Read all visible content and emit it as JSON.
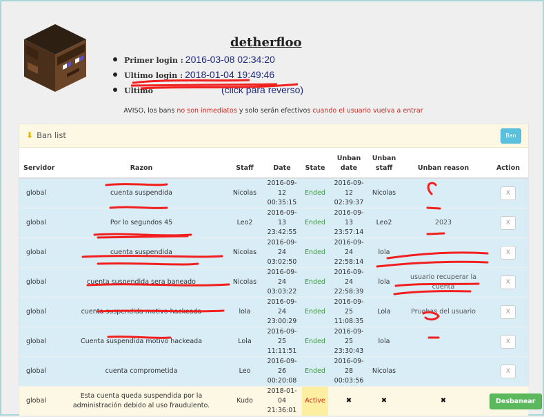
{
  "profile": {
    "username": "detherfloo",
    "first_login_label": "Primer login :",
    "first_login_value": "2016-03-08 02:34:20",
    "last_login_label": "Ultimo login :",
    "last_login_value": "2018-01-04 19:49:46",
    "last_ip_label": "Ultimo",
    "last_ip_value": "(click para reverso)"
  },
  "notice": {
    "prefix": "AVISO, los bans ",
    "highlight1": "no son inmediatos",
    "middle": " y solo serán efectivos ",
    "highlight2": "cuando el usuario vuelva a entrar"
  },
  "panel": {
    "title": "Ban list",
    "ban_button": "Ban"
  },
  "table": {
    "headers": [
      "Servidor",
      "Razon",
      "Staff",
      "Date",
      "State",
      "Unban date",
      "Unban staff",
      "Unban reason",
      "Action"
    ],
    "rows": [
      {
        "server": "global",
        "reason": "cuenta suspendida",
        "staff": "Nicolas",
        "date": "2016-09-12 00:35:15",
        "state": "Ended",
        "unban_date": "2016-09-12 02:39:37",
        "unban_staff": "Nicolas",
        "unban_reason": "",
        "action": "X"
      },
      {
        "server": "global",
        "reason": "Por lo segundos 45",
        "staff": "Leo2",
        "date": "2016-09-13 23:42:55",
        "state": "Ended",
        "unban_date": "2016-09-13 23:57:14",
        "unban_staff": "Leo2",
        "unban_reason": "2023",
        "action": "X"
      },
      {
        "server": "global",
        "reason": "cuenta suspendida",
        "staff": "Nicolas",
        "date": "2016-09-24 03:02:50",
        "state": "Ended",
        "unban_date": "2016-09-24 22:58:14",
        "unban_staff": "lola",
        "unban_reason": "",
        "action": "X"
      },
      {
        "server": "global",
        "reason": "cuenta suspendida sera baneado",
        "staff": "Nicolas",
        "date": "2016-09-24 03:03:22",
        "state": "Ended",
        "unban_date": "2016-09-24 22:58:39",
        "unban_staff": "lola",
        "unban_reason": "usuario recuperar la cuenta",
        "action": "X"
      },
      {
        "server": "global",
        "reason": "cuenta suspendida motivo hackeada",
        "staff": "lola",
        "date": "2016-09-24 23:00:29",
        "state": "Ended",
        "unban_date": "2016-09-25 11:08:35",
        "unban_staff": "Lola",
        "unban_reason": "Pruebas del usuario",
        "action": "X"
      },
      {
        "server": "global",
        "reason": "Cuenta suspendida motivo hackeada",
        "staff": "Lola",
        "date": "2016-09-25 11:11:51",
        "state": "Ended",
        "unban_date": "2016-09-25 23:30:43",
        "unban_staff": "lola",
        "unban_reason": "",
        "action": "X"
      },
      {
        "server": "global",
        "reason": "cuenta comprometida",
        "staff": "Leo",
        "date": "2016-09-26 00:20:08",
        "state": "Ended",
        "unban_date": "2016-09-28 00:03:56",
        "unban_staff": "Nicolas",
        "unban_reason": "",
        "action": "X"
      },
      {
        "server": "global",
        "reason": "Esta cuenta queda suspendida por la administración debido al uso fraudulento.",
        "staff": "Kudo",
        "date": "2018-01-04 21:36:01",
        "state": "Active",
        "unban_date": "✖",
        "unban_staff": "✖",
        "unban_reason": "✖",
        "action": "Desbanear"
      }
    ]
  },
  "colors": {
    "accent_info": "#5bc0de",
    "success": "#5cb85c",
    "danger": "#d4271f",
    "row_info": "#d9edf7",
    "row_warning": "#fcf8e3"
  }
}
